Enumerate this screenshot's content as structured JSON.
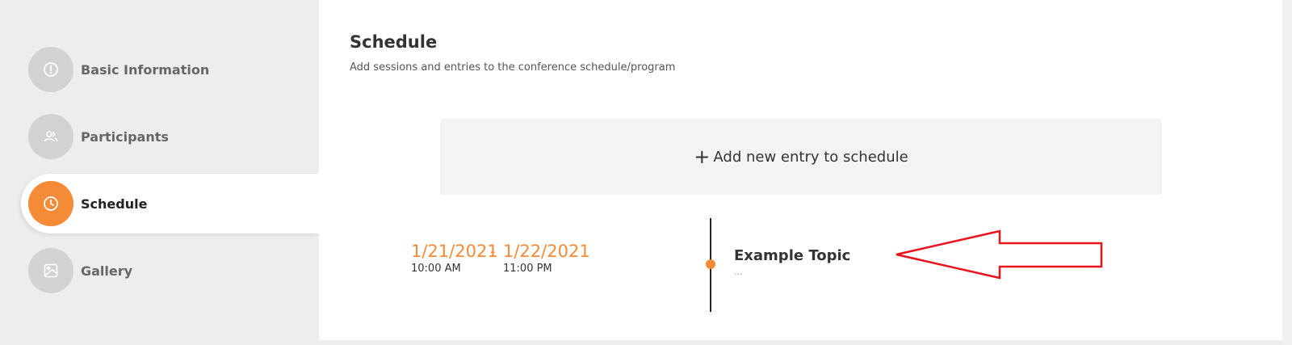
{
  "sidebar": {
    "items": [
      {
        "label": "Basic Information",
        "icon": "info-icon",
        "active": false
      },
      {
        "label": "Participants",
        "icon": "users-icon",
        "active": false
      },
      {
        "label": "Schedule",
        "icon": "clock-icon",
        "active": true
      },
      {
        "label": "Gallery",
        "icon": "image-icon",
        "active": false
      }
    ]
  },
  "main": {
    "title": "Schedule",
    "subtitle": "Add sessions and entries to the conference schedule/program",
    "add_entry_label": "Add new entry to schedule",
    "entries": [
      {
        "start_date": "1/21/2021",
        "start_time": "10:00 AM",
        "separator": "-",
        "end_date": "1/22/2021",
        "end_time": "11:00 PM",
        "topic": "Example Topic",
        "description": "..."
      }
    ]
  },
  "colors": {
    "accent": "#f58a37",
    "inactive_circle": "#d2d2d0",
    "annotation": "#e8141c"
  }
}
